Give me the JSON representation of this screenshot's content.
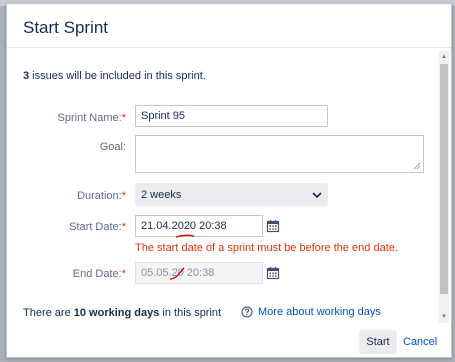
{
  "dialog": {
    "title": "Start Sprint",
    "summary_count": "3",
    "summary_text": " issues will be included in this sprint."
  },
  "form": {
    "sprint_name": {
      "label": "Sprint Name:",
      "value": "Sprint 95"
    },
    "goal": {
      "label": "Goal:",
      "value": ""
    },
    "duration": {
      "label": "Duration:",
      "value": "2 weeks"
    },
    "start_date": {
      "label": "Start Date:",
      "value": "21.04.2020 20:38"
    },
    "start_error": "The start date of a sprint must be before the end date.",
    "end_date": {
      "label": "End Date:",
      "value": "05.05.20 20:38"
    },
    "required_mark": "*"
  },
  "working_days": {
    "prefix": "There are ",
    "count": "10 working days",
    "suffix": " in this sprint",
    "link": "More about working days"
  },
  "footer": {
    "start_label": "Start",
    "cancel_label": "Cancel"
  },
  "colors": {
    "error": "#de350b",
    "link": "#0052cc"
  }
}
